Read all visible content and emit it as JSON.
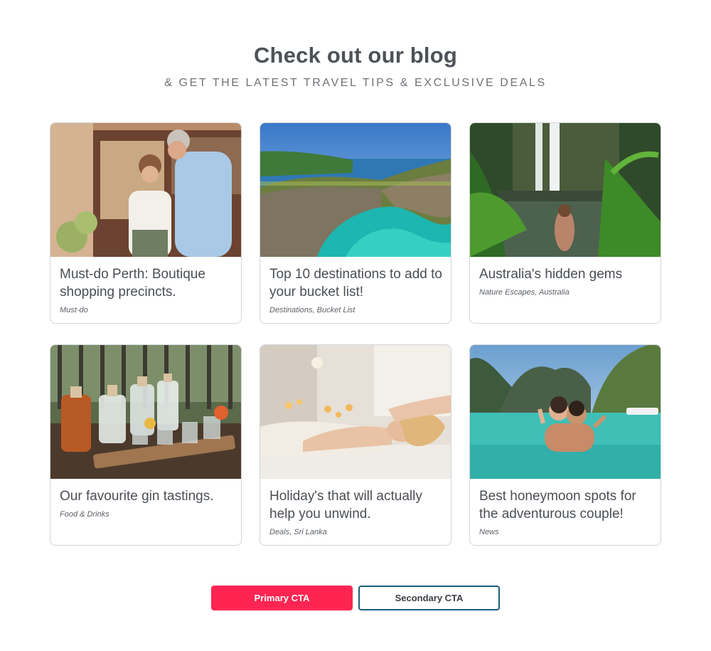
{
  "blog": {
    "title": "Check out our blog",
    "subtitle": "& GET THE LATEST TRAVEL TIPS & EXCLUSIVE DEALS"
  },
  "cards": [
    {
      "title": "Must-do Perth: Boutique shopping precincts.",
      "tags": "Must-do",
      "image": "boutique-shopping-photo"
    },
    {
      "title": "Top 10 destinations to add to your bucket list!",
      "tags": "Destinations, Bucket List",
      "image": "coastal-arch-photo"
    },
    {
      "title": "Australia's hidden gems",
      "tags": "Nature Escapes, Australia",
      "image": "waterfall-lagoon-photo"
    },
    {
      "title": "Our favourite gin tastings.",
      "tags": "Food & Drinks",
      "image": "gin-bottles-photo"
    },
    {
      "title": "Holiday's that will actually help you unwind.",
      "tags": "Deals, Sri Lanka",
      "image": "spa-massage-photo"
    },
    {
      "title": "Best honeymoon spots for the adventurous couple!",
      "tags": "News",
      "image": "couple-lagoon-photo"
    }
  ],
  "cta": {
    "primary": "Primary CTA",
    "secondary": "Secondary CTA"
  },
  "colors": {
    "primary": "#ff2552",
    "secondary_border": "#1d5e7a",
    "heading": "#4d5257"
  }
}
